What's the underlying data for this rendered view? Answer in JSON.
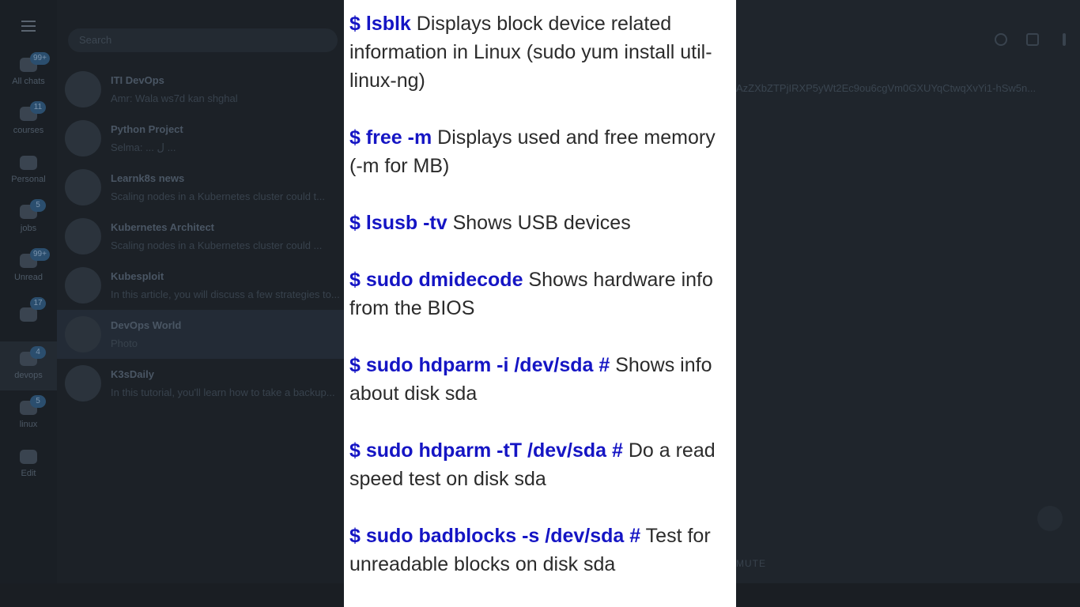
{
  "folders": [
    {
      "label": "All chats",
      "badge": "99+",
      "active": false
    },
    {
      "label": "courses",
      "badge": "11",
      "active": false
    },
    {
      "label": "Personal",
      "badge": "",
      "active": false
    },
    {
      "label": "jobs",
      "badge": "5",
      "active": false
    },
    {
      "label": "Unread",
      "badge": "99+",
      "active": false
    },
    {
      "label": "",
      "badge": "17",
      "active": false
    },
    {
      "label": "devops",
      "badge": "4",
      "active": true
    },
    {
      "label": "linux",
      "badge": "5",
      "active": false
    },
    {
      "label": "Edit",
      "badge": "",
      "active": false
    }
  ],
  "search": {
    "placeholder": "Search"
  },
  "chats": [
    {
      "name": "ITI DevOps",
      "preview": "Amr: Wala ws7d kan shghal",
      "active": false
    },
    {
      "name": "Python Project",
      "preview": "Selma: ... ل ...",
      "active": false
    },
    {
      "name": "Learnk8s news",
      "preview": "Scaling nodes in a Kubernetes cluster could t...",
      "active": false
    },
    {
      "name": "Kubernetes Architect",
      "preview": "Scaling nodes in a Kubernetes cluster could ...",
      "active": false
    },
    {
      "name": "Kubesploit",
      "preview": "In this article, you will discuss a few strategies to...",
      "active": false
    },
    {
      "name": "DevOps World",
      "preview": "Photo",
      "active": true
    },
    {
      "name": "K3sDaily",
      "preview": "In this tutorial, you'll learn how to take a backup...",
      "active": false
    }
  ],
  "conversation": {
    "pinned_text": "AzZXbZTPjIRXP5yWt2Ec9ou6cgVm0GXUYqCtwqXvYi1-hSw5n...",
    "mute_label": "MUTE"
  },
  "viewer": {
    "entries": [
      {
        "cmd": "$ lsblk",
        "desc": " Displays block device related information in Linux (sudo yum install util-linux-ng)"
      },
      {
        "cmd": "$ free -m",
        "desc": " Displays used and free memory (-m for MB)"
      },
      {
        "cmd": "$ lsusb -tv",
        "desc": " Shows USB devices"
      },
      {
        "cmd": "$ sudo dmidecode",
        "desc": " Shows hardware info from the BIOS"
      },
      {
        "cmd": "$ sudo hdparm -i /dev/sda #",
        "desc": " Shows info about disk sda"
      },
      {
        "cmd": "$ sudo hdparm -tT /dev/sda #",
        "desc": " Do a read speed test on disk sda"
      },
      {
        "cmd": "$ sudo badblocks -s /dev/sda #",
        "desc": " Test for unreadable blocks on disk sda"
      }
    ]
  }
}
